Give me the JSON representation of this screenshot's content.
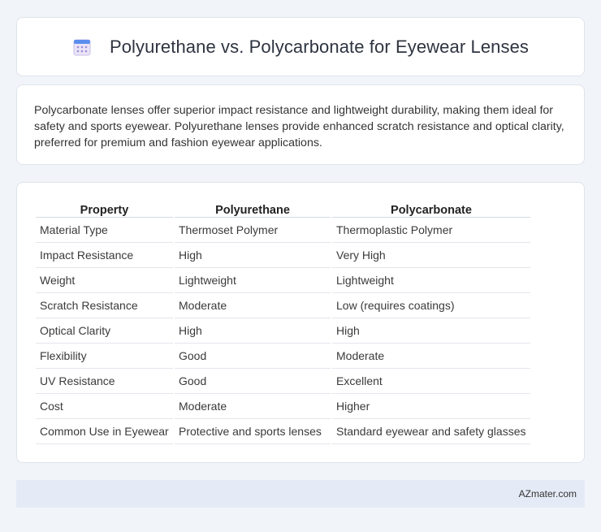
{
  "header": {
    "title": "Polyurethane vs. Polycarbonate for Eyewear Lenses",
    "icon": "calendar-icon"
  },
  "summary": {
    "text": "Polycarbonate lenses offer superior impact resistance and lightweight durability, making them ideal for safety and sports eyewear. Polyurethane lenses provide enhanced scratch resistance and optical clarity, preferred for premium and fashion eyewear applications."
  },
  "table": {
    "headers": [
      "Property",
      "Polyurethane",
      "Polycarbonate"
    ],
    "rows": [
      [
        "Material Type",
        "Thermoset Polymer",
        "Thermoplastic Polymer"
      ],
      [
        "Impact Resistance",
        "High",
        "Very High"
      ],
      [
        "Weight",
        "Lightweight",
        "Lightweight"
      ],
      [
        "Scratch Resistance",
        "Moderate",
        "Low (requires coatings)"
      ],
      [
        "Optical Clarity",
        "High",
        "High"
      ],
      [
        "Flexibility",
        "Good",
        "Moderate"
      ],
      [
        "UV Resistance",
        "Good",
        "Excellent"
      ],
      [
        "Cost",
        "Moderate",
        "Higher"
      ],
      [
        "Common Use in Eyewear",
        "Protective and sports lenses",
        "Standard eyewear and safety glasses"
      ]
    ]
  },
  "footer": {
    "site": "AZmater.com"
  },
  "colors": {
    "background": "#f1f4f9",
    "footer_bg": "#e5ebf6",
    "icon_accent": "#5b8def"
  }
}
